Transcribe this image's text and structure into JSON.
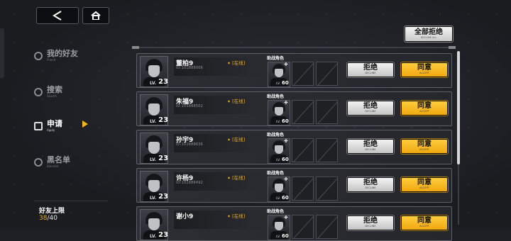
{
  "sidebar": {
    "items": [
      {
        "label": "我的好友",
        "sub": "Friend",
        "icon": "friend-icon"
      },
      {
        "label": "搜索",
        "sub": "Search",
        "icon": "search-icon"
      },
      {
        "label": "申请",
        "sub": "Apply",
        "icon": "apply-icon"
      },
      {
        "label": "黑名单",
        "sub": "Blacklist",
        "icon": "blacklist-icon"
      }
    ],
    "active_index": 2
  },
  "friend_limit": {
    "label": "好友上限",
    "current": "38",
    "max": "/40"
  },
  "reject_all": {
    "label": "全部拒绝",
    "sub": "DECLINE ALL"
  },
  "support_label": "助战角色",
  "reject_label": "拒绝",
  "reject_sub": "DECLINE",
  "accept_label": "同意",
  "accept_sub": "ACCEPT",
  "lv_tag": "LV.",
  "requests": [
    {
      "name": "董柏9",
      "id": "ID:101888006",
      "status": "[在线]",
      "level": "23",
      "support_level": "60"
    },
    {
      "name": "朱福9",
      "id": "ID:101888502",
      "status": "[在线]",
      "level": "23",
      "support_level": "60"
    },
    {
      "name": "孙宇9",
      "id": "ID:101888636",
      "status": "[在线]",
      "level": "23",
      "support_level": "60"
    },
    {
      "name": "许杨9",
      "id": "ID:101888492",
      "status": "[在线]",
      "level": "23",
      "support_level": "60"
    },
    {
      "name": "谢小9",
      "id": "",
      "status": "[在线]",
      "level": "23",
      "support_level": "60"
    }
  ],
  "colors": {
    "accent": "#f0b21d",
    "accept": "#ffc21c",
    "reject": "#e6e6e6"
  }
}
